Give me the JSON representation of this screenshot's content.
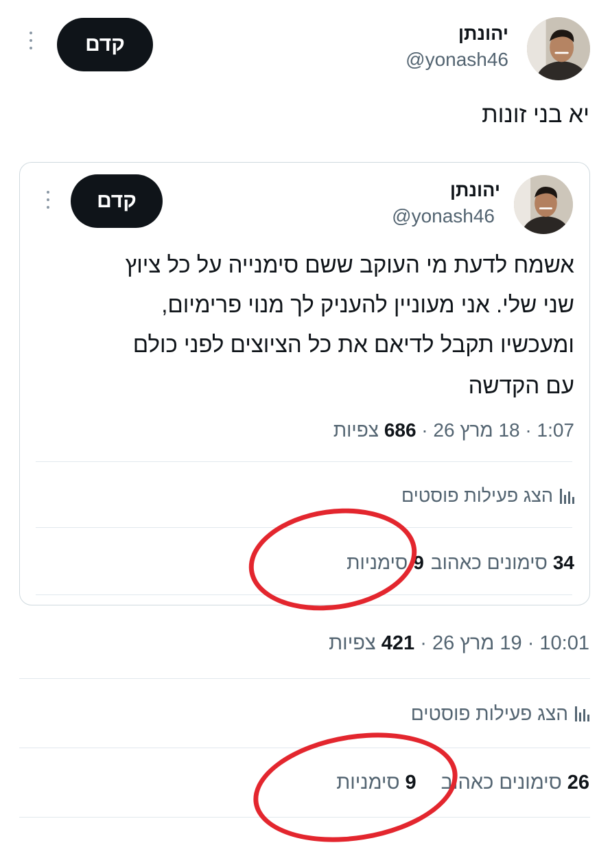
{
  "main_tweet": {
    "author_name": "יהונתן",
    "author_handle": "@yonash46",
    "follow_label": "קדם",
    "text": "יא בני זונות",
    "time": "10:01",
    "date": "19 מרץ 26",
    "views_count": "421",
    "views_label": "צפיות",
    "activity_label": "הצג פעילות פוסטים",
    "likes_count": "26",
    "likes_label": "סימונים כאהוב",
    "bookmarks_count": "9",
    "bookmarks_label": "סימניות"
  },
  "quoted_tweet": {
    "author_name": "יהונתן",
    "author_handle": "@yonash46",
    "follow_label": "קדם",
    "text_lines": [
      "אשמח לדעת מי העוקב ששם סימנייה על כל ציוץ",
      "שני שלי. אני מעוניין להעניק לך מנוי פרימיום,",
      "ומעכשיו תקבל לדיאם את כל הציוצים לפני כולם",
      "עם הקדשה"
    ],
    "time": "1:07",
    "date": "18 מרץ 26",
    "views_count": "686",
    "views_label": "צפיות",
    "activity_label": "הצג פעילות פוסטים",
    "likes_count": "34",
    "likes_label": "סימונים כאהוב",
    "bookmarks_count": "9",
    "bookmarks_label": "סימניות"
  },
  "annotation_color": "#e3262e",
  "icons": {
    "more": "more-dots-icon",
    "activity": "bar-chart-icon"
  }
}
